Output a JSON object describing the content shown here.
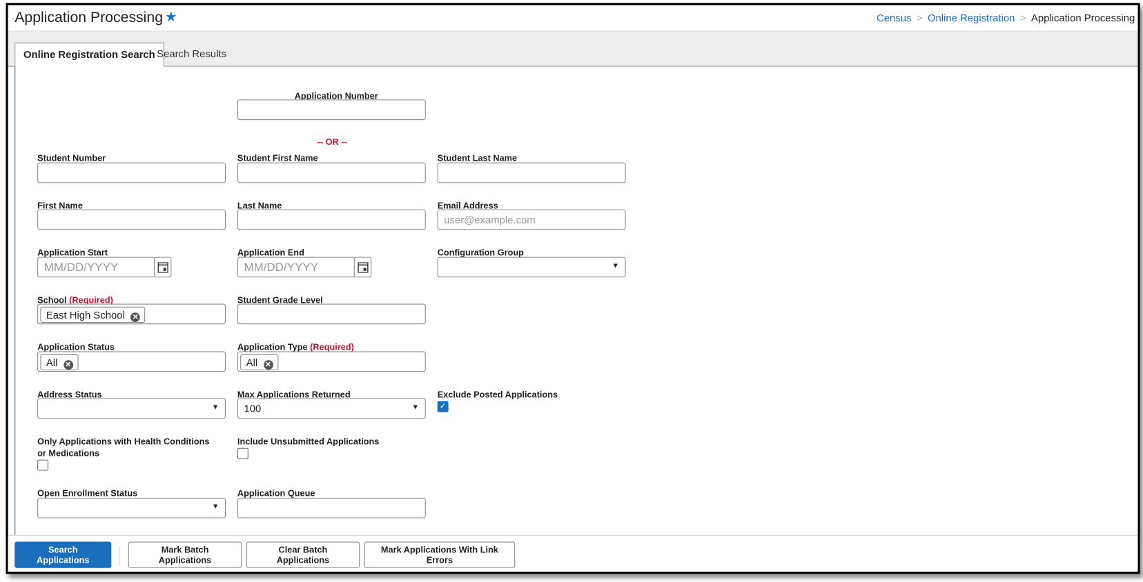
{
  "header": {
    "title": "Application Processing",
    "breadcrumbs": [
      "Census",
      "Online Registration",
      "Application Processing"
    ]
  },
  "tabs": [
    "Online Registration Search",
    "Search Results"
  ],
  "form": {
    "or_text": "-- OR --",
    "required": "(Required)",
    "application_number": "Application Number",
    "student_number": "Student Number",
    "student_first_name": "Student First Name",
    "student_last_name": "Student Last Name",
    "first_name": "First Name",
    "last_name": "Last Name",
    "email_address": "Email Address",
    "email_placeholder": "user@example.com",
    "application_start": "Application Start",
    "application_end": "Application End",
    "date_placeholder": "MM/DD/YYYY",
    "configuration_group": "Configuration Group",
    "school": "School",
    "school_value": "East High School",
    "student_grade_level": "Student Grade Level",
    "application_status": "Application Status",
    "application_status_value": "All",
    "application_type": "Application Type",
    "application_type_value": "All",
    "address_status": "Address Status",
    "max_applications": "Max Applications Returned",
    "max_applications_value": "100",
    "exclude_posted": "Exclude Posted Applications",
    "exclude_posted_checked": true,
    "health_conditions": "Only Applications with Health Conditions or Medications",
    "health_conditions_checked": false,
    "include_unsubmitted": "Include Unsubmitted Applications",
    "include_unsubmitted_checked": false,
    "open_enrollment_status": "Open Enrollment Status",
    "application_queue": "Application Queue"
  },
  "footer": {
    "search": "Search Applications",
    "mark_batch": "Mark Batch Applications",
    "clear_batch": "Clear Batch Applications",
    "mark_link_errors": "Mark Applications With Link Errors"
  }
}
